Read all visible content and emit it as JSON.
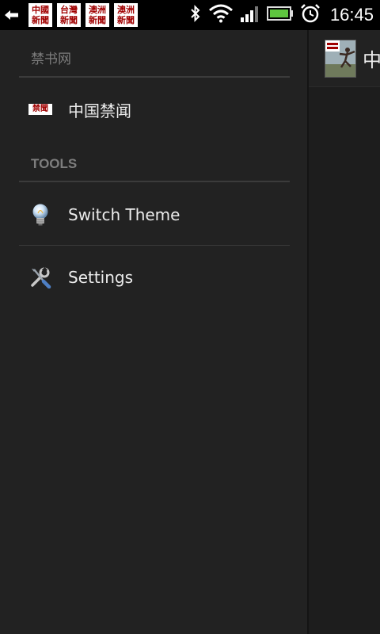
{
  "status_bar": {
    "notifications": [
      {
        "line1": "中國",
        "line2": "新聞"
      },
      {
        "line1": "台灣",
        "line2": "新聞"
      },
      {
        "line1": "澳洲",
        "line2": "新聞"
      },
      {
        "line1": "澳洲",
        "line2": "新聞"
      }
    ],
    "time": "16:45",
    "battery_color": "#5ec53f"
  },
  "drawer": {
    "feeds_section": {
      "title": "禁书网",
      "items": [
        {
          "label": "中国禁闻",
          "logo_text": "禁聞"
        }
      ]
    },
    "tools_section": {
      "title": "TOOLS",
      "items": [
        {
          "label": "Switch Theme",
          "icon": "lightbulb-icon"
        },
        {
          "label": "Settings",
          "icon": "wrench-screwdriver-icon"
        }
      ]
    }
  },
  "action_bar": {
    "title": "中"
  }
}
